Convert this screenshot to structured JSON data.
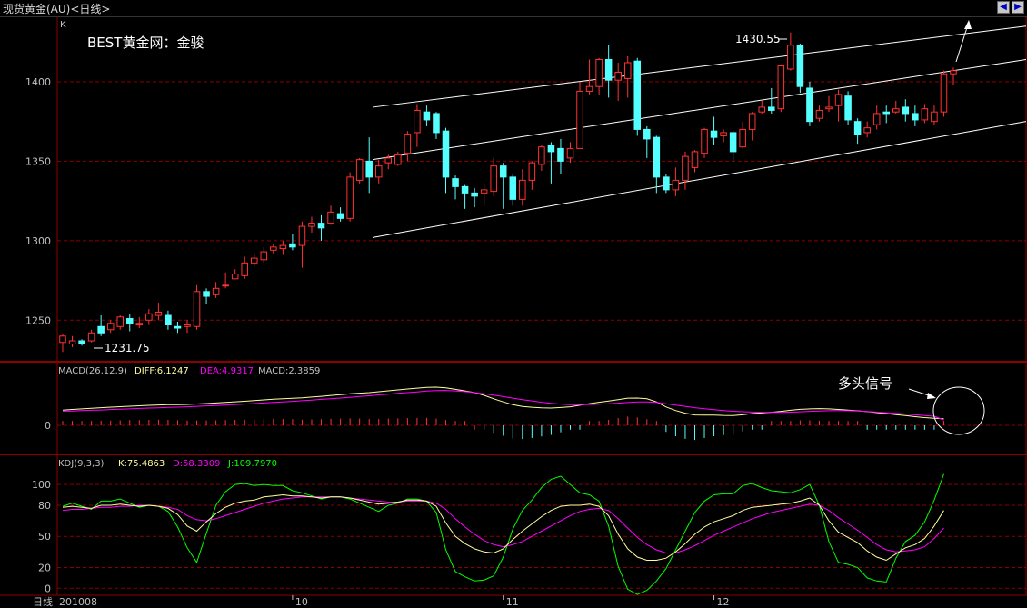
{
  "window": {
    "title": "现货黄金(AU)<日线>",
    "nav_left_icon": "arrow-left-icon",
    "nav_right_icon": "arrow-right-icon"
  },
  "colors": {
    "up": "#ff3232",
    "down": "#54ffff",
    "grid": "#8c0000",
    "frame": "#8c0000",
    "diff": "#ffffa0",
    "dea": "#ff00ff",
    "k": "#ffffa0",
    "d": "#ff00ff",
    "j": "#00ff00",
    "hist_up": "#ff3232",
    "hist_down": "#54ffff",
    "channel": "#ffffff"
  },
  "main_panel": {
    "corner_label": "K",
    "watermark": "BEST黄金网：金骏",
    "high_label": "1430.55",
    "low_label": "1231.75",
    "y_ticks": [
      "1250",
      "1300",
      "1350",
      "1400"
    ]
  },
  "macd_panel": {
    "name": "MACD(26,12,9)",
    "diff_label": "DIFF:6.1247",
    "dea_label": "DEA:4.9317",
    "macd_label": "MACD:2.3859",
    "y_ticks": [
      "0"
    ],
    "signal_annotation": "多头信号"
  },
  "kdj_panel": {
    "name": "KDJ(9,3,3)",
    "k_label": "K:75.4863",
    "d_label": "D:58.3309",
    "j_label": "J:109.7970",
    "y_ticks": [
      "100",
      "80",
      "50",
      "20",
      "0"
    ]
  },
  "x_axis": {
    "period_label": "日线",
    "labels": [
      "201008",
      "10",
      "11",
      "12"
    ]
  },
  "chart_data": {
    "type": "candlestick",
    "ylim": [
      1225,
      1440
    ],
    "candles": [
      [
        1236,
        1240,
        1230,
        1241
      ],
      [
        1235,
        1237,
        1233,
        1240
      ],
      [
        1237,
        1235,
        1234,
        1238
      ],
      [
        1237,
        1242,
        1236,
        1244
      ],
      [
        1246,
        1242,
        1240,
        1253
      ],
      [
        1244,
        1248,
        1242,
        1250
      ],
      [
        1246,
        1252,
        1244,
        1253
      ],
      [
        1251,
        1248,
        1243,
        1254
      ],
      [
        1247,
        1248,
        1245,
        1252
      ],
      [
        1250,
        1254,
        1247,
        1257
      ],
      [
        1253,
        1255,
        1250,
        1261
      ],
      [
        1253,
        1247,
        1244,
        1256
      ],
      [
        1246,
        1245,
        1242,
        1249
      ],
      [
        1246,
        1247,
        1242,
        1250
      ],
      [
        1246,
        1268,
        1244,
        1272
      ],
      [
        1268,
        1265,
        1260,
        1270
      ],
      [
        1266,
        1270,
        1264,
        1274
      ],
      [
        1272,
        1272,
        1270,
        1280
      ],
      [
        1276,
        1279,
        1276,
        1282
      ],
      [
        1278,
        1286,
        1276,
        1290
      ],
      [
        1286,
        1289,
        1284,
        1292
      ],
      [
        1288,
        1293,
        1286,
        1296
      ],
      [
        1294,
        1296,
        1292,
        1298
      ],
      [
        1295,
        1297,
        1291,
        1300
      ],
      [
        1298,
        1296,
        1294,
        1304
      ],
      [
        1297,
        1309,
        1283,
        1312
      ],
      [
        1309,
        1311,
        1305,
        1315
      ],
      [
        1311,
        1308,
        1300,
        1316
      ],
      [
        1311,
        1318,
        1310,
        1322
      ],
      [
        1317,
        1314,
        1312,
        1321
      ],
      [
        1314,
        1340,
        1312,
        1343
      ],
      [
        1338,
        1351,
        1336,
        1352
      ],
      [
        1350,
        1340,
        1330,
        1365
      ],
      [
        1340,
        1347,
        1336,
        1351
      ],
      [
        1349,
        1352,
        1345,
        1354
      ],
      [
        1348,
        1354,
        1347,
        1356
      ],
      [
        1355,
        1367,
        1350,
        1369
      ],
      [
        1368,
        1382,
        1359,
        1386
      ],
      [
        1381,
        1376,
        1372,
        1385
      ],
      [
        1380,
        1368,
        1364,
        1381
      ],
      [
        1369,
        1340,
        1330,
        1371
      ],
      [
        1339,
        1334,
        1326,
        1341
      ],
      [
        1334,
        1330,
        1320,
        1335
      ],
      [
        1330,
        1328,
        1321,
        1333
      ],
      [
        1330,
        1332,
        1322,
        1336
      ],
      [
        1331,
        1347,
        1328,
        1352
      ],
      [
        1347,
        1340,
        1320,
        1349
      ],
      [
        1340,
        1326,
        1322,
        1342
      ],
      [
        1326,
        1338,
        1322,
        1345
      ],
      [
        1338,
        1349,
        1332,
        1350
      ],
      [
        1348,
        1359,
        1344,
        1360
      ],
      [
        1360,
        1356,
        1336,
        1362
      ],
      [
        1358,
        1350,
        1342,
        1364
      ],
      [
        1352,
        1358,
        1349,
        1362
      ],
      [
        1358,
        1394,
        1358,
        1400
      ],
      [
        1394,
        1397,
        1392,
        1414
      ],
      [
        1397,
        1414,
        1392,
        1415
      ],
      [
        1414,
        1401,
        1390,
        1423
      ],
      [
        1401,
        1406,
        1388,
        1412
      ],
      [
        1402,
        1412,
        1390,
        1416
      ],
      [
        1413,
        1370,
        1366,
        1415
      ],
      [
        1370,
        1364,
        1352,
        1372
      ],
      [
        1365,
        1340,
        1330,
        1366
      ],
      [
        1340,
        1332,
        1330,
        1342
      ],
      [
        1332,
        1338,
        1328,
        1346
      ],
      [
        1338,
        1353,
        1332,
        1356
      ],
      [
        1346,
        1356,
        1343,
        1357
      ],
      [
        1355,
        1370,
        1352,
        1371
      ],
      [
        1369,
        1365,
        1360,
        1378
      ],
      [
        1366,
        1368,
        1362,
        1370
      ],
      [
        1368,
        1356,
        1350,
        1369
      ],
      [
        1359,
        1370,
        1358,
        1375
      ],
      [
        1370,
        1380,
        1363,
        1381
      ],
      [
        1381,
        1384,
        1380,
        1388
      ],
      [
        1384,
        1382,
        1380,
        1396
      ],
      [
        1383,
        1410,
        1381,
        1411
      ],
      [
        1408,
        1423,
        1407,
        1431
      ],
      [
        1423,
        1397,
        1393,
        1424
      ],
      [
        1396,
        1375,
        1372,
        1400
      ],
      [
        1377,
        1382,
        1375,
        1385
      ],
      [
        1383,
        1384,
        1381,
        1391
      ],
      [
        1385,
        1392,
        1375,
        1395
      ],
      [
        1391,
        1376,
        1373,
        1394
      ],
      [
        1375,
        1367,
        1361,
        1377
      ],
      [
        1368,
        1371,
        1365,
        1375
      ],
      [
        1373,
        1380,
        1370,
        1385
      ],
      [
        1381,
        1380,
        1374,
        1385
      ],
      [
        1381,
        1383,
        1380,
        1388
      ],
      [
        1384,
        1380,
        1375,
        1389
      ],
      [
        1380,
        1376,
        1372,
        1385
      ],
      [
        1376,
        1383,
        1374,
        1386
      ],
      [
        1375,
        1381,
        1373,
        1385
      ],
      [
        1381,
        1405,
        1378,
        1407
      ],
      [
        1405,
        1407,
        1398,
        1409
      ]
    ],
    "channel_lines": [
      {
        "name": "upper",
        "start": [
          1,
          1384
        ],
        "end": [
          12,
          1435
        ]
      },
      {
        "name": "middle",
        "start": [
          1,
          1351
        ],
        "end": [
          12,
          1414
        ]
      },
      {
        "name": "lower",
        "start": [
          1,
          1302
        ],
        "end": [
          12,
          1375
        ]
      }
    ],
    "macd": {
      "ylim": [
        -25,
        45
      ],
      "diff": [
        14,
        14.6,
        15.1,
        15.6,
        16.2,
        16.7,
        17.1,
        17.5,
        17.9,
        18.3,
        18.7,
        18.9,
        19,
        19.2,
        19.6,
        20,
        20.5,
        21,
        21.6,
        22.1,
        22.7,
        23.3,
        23.9,
        24.4,
        24.8,
        25.2,
        25.9,
        26.6,
        27.4,
        28.1,
        28.9,
        29.5,
        30,
        30.8,
        31.7,
        32.5,
        33.3,
        34.1,
        34.8,
        35,
        34.4,
        33,
        31.6,
        30,
        27.5,
        24.3,
        21.5,
        18.9,
        17.3,
        16.6,
        16.1,
        15.8,
        16.3,
        17,
        18.4,
        19.9,
        21.2,
        22.3,
        23.6,
        24.9,
        25,
        24.3,
        21.5,
        16.8,
        13.6,
        11.2,
        9.5,
        9.4,
        9.4,
        9.1,
        9,
        9.7,
        10.8,
        11.3,
        12,
        12.8,
        13.8,
        14.7,
        15.1,
        15.3,
        15.1,
        14.6,
        14,
        13.3,
        12.6,
        11.7,
        10.8,
        9.8,
        8.9,
        7.9,
        7.1,
        6.5,
        6.1
      ],
      "dea": [
        13,
        13.2,
        13.5,
        13.8,
        14.1,
        14.5,
        14.8,
        15.1,
        15.5,
        15.8,
        16.1,
        16.4,
        16.7,
        17,
        17.4,
        17.8,
        18.2,
        18.6,
        19.1,
        19.5,
        20,
        20.5,
        21,
        21.5,
        22,
        22.6,
        23.2,
        23.8,
        24.4,
        25,
        25.7,
        26.4,
        27.1,
        27.9,
        28.6,
        29.3,
        30,
        30.7,
        31.4,
        31.9,
        32,
        31.6,
        30.9,
        30,
        28.9,
        27.7,
        26.3,
        24.9,
        23.6,
        22.4,
        21.2,
        20.2,
        19.5,
        19,
        18.9,
        19.1,
        19.4,
        19.8,
        20.3,
        20.9,
        21.4,
        21.5,
        21,
        19.8,
        18.6,
        17.4,
        16.2,
        15.2,
        14.4,
        13.6,
        12.9,
        12.5,
        12.2,
        12,
        11.9,
        11.9,
        12.1,
        12.4,
        12.8,
        13.2,
        13.4,
        13.5,
        13.4,
        13.1,
        12.7,
        12.2,
        11.6,
        11,
        10.4,
        9.7,
        9,
        8.3,
        4.9
      ]
    },
    "kdj": {
      "ylim": [
        -5,
        115
      ],
      "k": [
        78,
        79,
        78,
        77,
        80,
        80,
        81,
        80,
        79,
        80,
        79,
        77,
        71,
        60,
        55,
        64,
        72,
        78,
        82,
        84,
        85,
        88,
        89,
        90,
        89,
        89,
        88,
        87,
        88,
        88,
        87,
        85,
        83,
        81,
        82,
        83,
        85,
        85,
        84,
        79,
        63,
        50,
        43,
        38,
        35,
        34,
        38,
        47,
        55,
        62,
        69,
        75,
        79,
        80,
        80,
        81,
        79,
        70,
        52,
        38,
        30,
        27,
        27,
        29,
        35,
        43,
        52,
        59,
        64,
        67,
        70,
        75,
        78,
        79,
        80,
        81,
        82,
        84,
        87,
        80,
        65,
        54,
        49,
        44,
        36,
        30,
        27,
        33,
        39,
        42,
        48,
        60,
        75
      ],
      "d": [
        75,
        76,
        76,
        77,
        78,
        78,
        79,
        79,
        80,
        80,
        79,
        78,
        76,
        70,
        66,
        65,
        67,
        70,
        73,
        76,
        79,
        82,
        84,
        86,
        87,
        88,
        88,
        88,
        88,
        88,
        87,
        86,
        85,
        84,
        83,
        83,
        84,
        84,
        84,
        82,
        76,
        67,
        59,
        52,
        46,
        42,
        40,
        42,
        45,
        50,
        55,
        60,
        65,
        70,
        74,
        76,
        77,
        75,
        67,
        58,
        49,
        42,
        37,
        34,
        34,
        37,
        41,
        46,
        51,
        55,
        59,
        63,
        67,
        70,
        73,
        75,
        77,
        79,
        81,
        80,
        75,
        68,
        62,
        56,
        49,
        42,
        37,
        35,
        36,
        37,
        40,
        48,
        58
      ],
      "j": [
        79,
        82,
        79,
        76,
        84,
        84,
        86,
        82,
        78,
        80,
        79,
        74,
        59,
        39,
        25,
        53,
        80,
        93,
        100,
        101,
        99,
        100,
        99,
        99,
        94,
        92,
        89,
        86,
        88,
        88,
        86,
        82,
        78,
        74,
        80,
        82,
        86,
        86,
        84,
        73,
        37,
        16,
        11,
        7,
        8,
        12,
        30,
        57,
        75,
        85,
        97,
        105,
        108,
        100,
        92,
        90,
        84,
        60,
        21,
        -1,
        -6,
        -2,
        7,
        19,
        37,
        55,
        73,
        84,
        90,
        91,
        91,
        99,
        101,
        97,
        94,
        93,
        92,
        95,
        100,
        80,
        45,
        25,
        23,
        20,
        10,
        7,
        6,
        29,
        45,
        51,
        64,
        85,
        110
      ]
    }
  }
}
